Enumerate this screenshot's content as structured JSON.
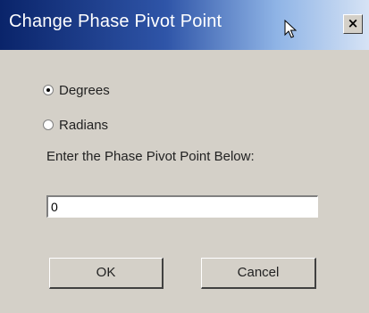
{
  "window": {
    "title": "Change Phase Pivot Point",
    "close_label": "×"
  },
  "units": {
    "options": [
      {
        "label": "Degrees",
        "selected": true
      },
      {
        "label": "Radians",
        "selected": false
      }
    ]
  },
  "prompt": {
    "label": "Enter the Phase Pivot Point Below:",
    "value": "0"
  },
  "buttons": {
    "ok_label": "OK",
    "cancel_label": "Cancel"
  },
  "colors": {
    "titlebar_start": "#0a246a",
    "titlebar_end": "#d6e3f5",
    "dialog_background": "#d4d0c8"
  }
}
